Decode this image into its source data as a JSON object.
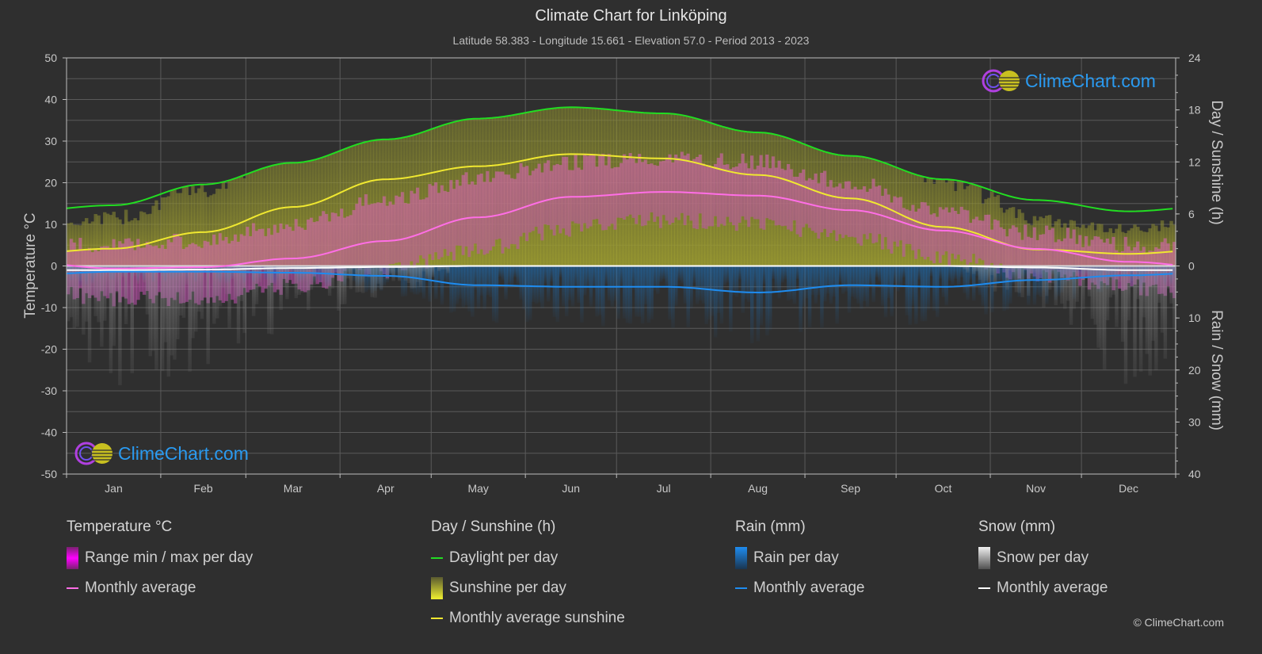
{
  "header": {
    "title": "Climate Chart for Linköping",
    "subtitle": "Latitude 58.383 - Longitude 15.661 - Elevation 57.0 - Period 2013 - 2023"
  },
  "logo": {
    "text": "ClimeChart.com"
  },
  "copyright": "© ClimeChart.com",
  "colors": {
    "background": "#2f2f2f",
    "temperature_range": "#e040e0",
    "temperature_avg": "#ff6ee6",
    "daylight": "#22dd22",
    "sunshine_bar": "#c8c832",
    "sunshine_avg": "#f0e830",
    "rain_bar": "#1e78c8",
    "rain_avg": "#1e8cf0",
    "snow_bar": "#9a9a9a",
    "snow_avg": "#ffffff",
    "logo_text": "#2a9af0"
  },
  "chart_data": {
    "type": "line",
    "title": "Climate Chart for Linköping",
    "categories": [
      "Jan",
      "Feb",
      "Mar",
      "Apr",
      "May",
      "Jun",
      "Jul",
      "Aug",
      "Sep",
      "Oct",
      "Nov",
      "Dec"
    ],
    "axes": {
      "left": {
        "label": "Temperature °C",
        "range": [
          -50,
          50
        ],
        "ticks": [
          "50",
          "40",
          "30",
          "20",
          "10",
          "0",
          "-10",
          "-20",
          "-30",
          "-40",
          "-50"
        ]
      },
      "right_top": {
        "label": "Day / Sunshine (h)",
        "range": [
          0,
          24
        ],
        "ticks": [
          "24",
          "18",
          "12",
          "6",
          "0"
        ]
      },
      "right_bottom": {
        "label": "Rain / Snow (mm)",
        "range": [
          0,
          40
        ],
        "ticks": [
          "10",
          "20",
          "30",
          "40"
        ]
      }
    },
    "grid": true,
    "series": [
      {
        "name": "Temperature monthly average",
        "axis": "left",
        "unit": "°C",
        "values": [
          -0.6,
          -0.3,
          1.8,
          6.0,
          11.7,
          16.6,
          17.8,
          16.9,
          13.4,
          8.5,
          4.1,
          1.0
        ]
      },
      {
        "name": "Daylight per day",
        "axis": "right_top",
        "unit": "h",
        "values": [
          7.0,
          9.4,
          11.9,
          14.6,
          17.0,
          18.3,
          17.6,
          15.4,
          12.7,
          10.0,
          7.6,
          6.3
        ]
      },
      {
        "name": "Monthly average sunshine",
        "axis": "right_top",
        "unit": "h",
        "values": [
          2.0,
          3.9,
          6.8,
          10.0,
          11.5,
          12.9,
          12.4,
          10.5,
          7.8,
          4.5,
          1.9,
          1.4
        ]
      },
      {
        "name": "Rain monthly average",
        "axis": "right_bottom",
        "unit": "mm",
        "values": [
          1.1,
          1.1,
          1.3,
          1.9,
          3.7,
          4.0,
          4.0,
          5.1,
          3.7,
          4.0,
          2.7,
          1.8
        ]
      },
      {
        "name": "Snow monthly average",
        "axis": "right_bottom",
        "unit": "mm",
        "values": [
          0.8,
          0.7,
          0.4,
          0.2,
          0.0,
          0.0,
          0.0,
          0.0,
          0.0,
          0.0,
          0.3,
          0.8
        ]
      }
    ],
    "temperature_range_approx": {
      "min": [
        -6,
        -6,
        -3,
        1,
        6,
        11,
        13,
        12,
        9,
        4,
        0,
        -3
      ],
      "max": [
        3,
        4,
        8,
        14,
        19,
        23,
        24,
        23,
        18,
        11,
        6,
        3
      ]
    }
  },
  "legend": {
    "groups": [
      {
        "title": "Temperature °C",
        "items": [
          {
            "kind": "bar",
            "label": "Range min / max per day"
          },
          {
            "kind": "line",
            "label": "Monthly average"
          }
        ]
      },
      {
        "title": "Day / Sunshine (h)",
        "items": [
          {
            "kind": "line",
            "label": "Daylight per day"
          },
          {
            "kind": "bar",
            "label": "Sunshine per day"
          },
          {
            "kind": "line",
            "label": "Monthly average sunshine"
          }
        ]
      },
      {
        "title": "Rain (mm)",
        "items": [
          {
            "kind": "bar",
            "label": "Rain per day"
          },
          {
            "kind": "line",
            "label": "Monthly average"
          }
        ]
      },
      {
        "title": "Snow (mm)",
        "items": [
          {
            "kind": "bar",
            "label": "Snow per day"
          },
          {
            "kind": "line",
            "label": "Monthly average"
          }
        ]
      }
    ]
  }
}
